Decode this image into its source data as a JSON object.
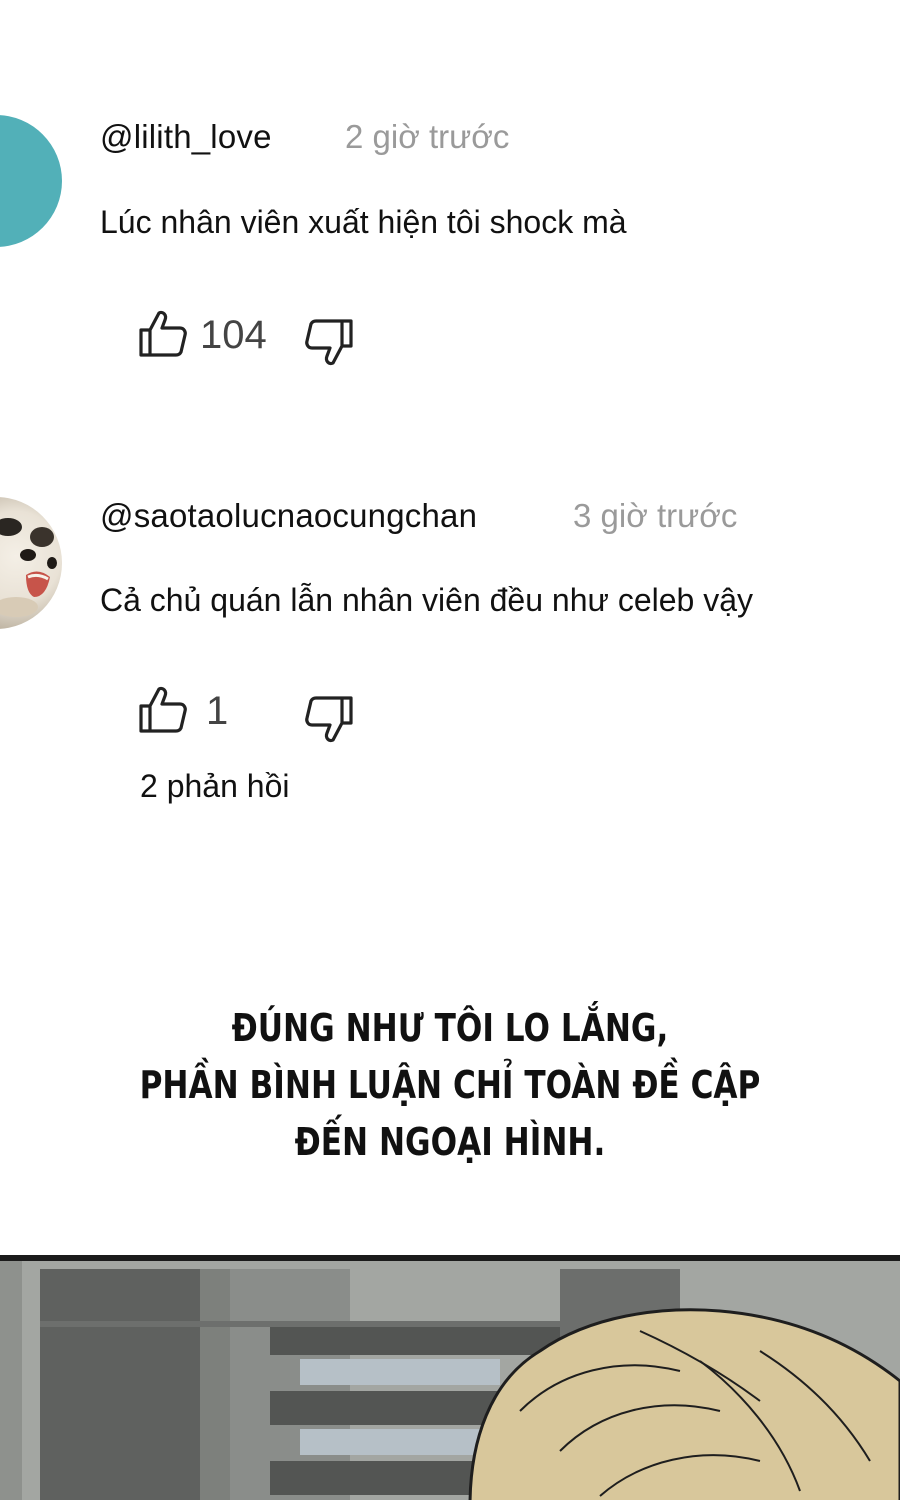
{
  "comments": [
    {
      "username": "@lilith_love",
      "timestamp": "2 giờ trước",
      "text": "Lúc nhân viên xuất hiện tôi shock mà",
      "likes": "104"
    },
    {
      "username": "@saotaolucnaocungchan",
      "timestamp": "3 giờ trước",
      "text": "Cả chủ quán lẫn nhân viên đều như celeb vậy",
      "likes": "1",
      "replies": "2 phản hồi"
    }
  ],
  "narration": [
    "ĐÚNG NHƯ TÔI LO LẮNG,",
    "PHẦN BÌNH LUẬN CHỈ TOÀN ĐỀ CẬP",
    "ĐẾN NGOẠI HÌNH."
  ],
  "icons": {
    "like": "thumbs-up-icon",
    "dislike": "thumbs-down-icon"
  },
  "colors": {
    "avatar_1": "#52b0b8",
    "timestamp": "#9a9a9a",
    "text": "#111111"
  }
}
